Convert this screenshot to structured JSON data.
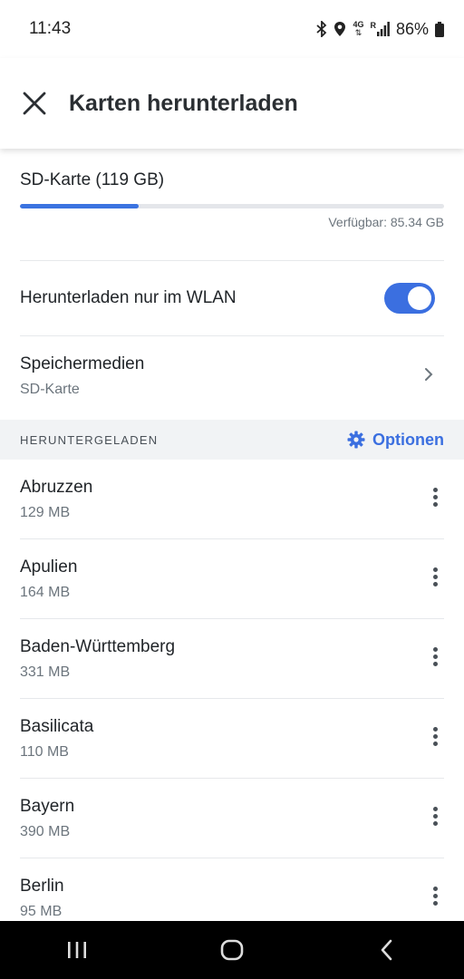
{
  "status_bar": {
    "time": "11:43",
    "network": "4G",
    "roaming": "R",
    "battery": "86%"
  },
  "app_bar": {
    "title": "Karten herunterladen",
    "close_icon": "close-icon"
  },
  "storage": {
    "title": "SD-Karte (119 GB)",
    "used_fraction": 0.28,
    "available": "Verfügbar: 85.34 GB"
  },
  "wifi_setting": {
    "label": "Herunterladen nur im WLAN",
    "enabled": true
  },
  "storage_media": {
    "title": "Speichermedien",
    "value": "SD-Karte"
  },
  "downloaded_section": {
    "title": "HERUNTERGELADEN",
    "options_label": "Optionen",
    "options_icon": "gear-icon"
  },
  "maps": [
    {
      "name": "Abruzzen",
      "size": "129 MB"
    },
    {
      "name": "Apulien",
      "size": "164 MB"
    },
    {
      "name": "Baden-Württemberg",
      "size": "331 MB"
    },
    {
      "name": "Basilicata",
      "size": "110 MB"
    },
    {
      "name": "Bayern",
      "size": "390 MB"
    },
    {
      "name": "Berlin",
      "size": "95 MB"
    }
  ],
  "colors": {
    "accent": "#3b6fe0",
    "section_bg": "#f1f3f5"
  }
}
